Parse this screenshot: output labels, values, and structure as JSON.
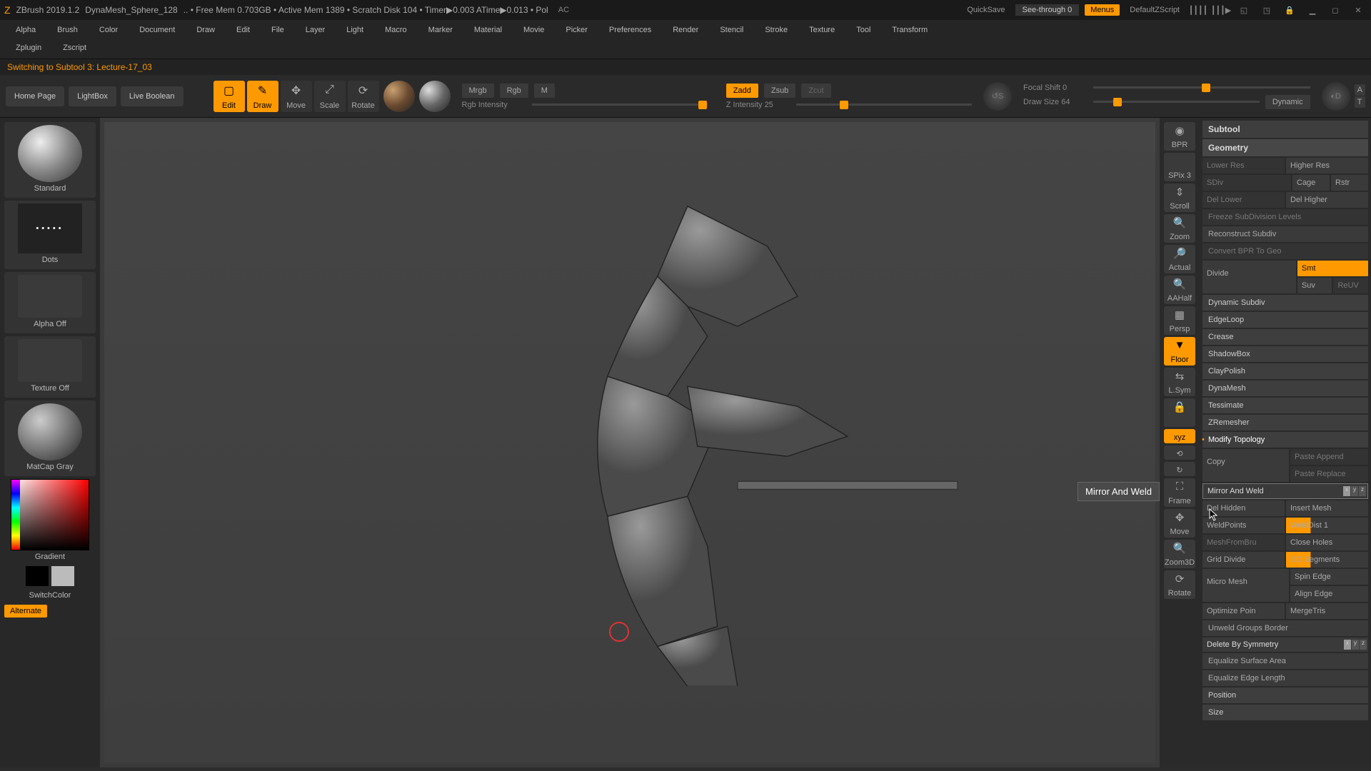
{
  "titlebar": {
    "app": "ZBrush 2019.1.2",
    "doc": "DynaMesh_Sphere_128",
    "stats": ".. • Free Mem 0.703GB • Active Mem 1389 • Scratch Disk 104 • Timer▶0.003 ATime▶0.013 • Pol",
    "ac": "AC",
    "quicksave": "QuickSave",
    "seethrough": "See-through  0",
    "menus": "Menus",
    "default_zscript": "DefaultZScript"
  },
  "menu": {
    "items": [
      "Alpha",
      "Brush",
      "Color",
      "Document",
      "Draw",
      "Edit",
      "File",
      "Layer",
      "Light",
      "Macro",
      "Marker",
      "Material",
      "Movie",
      "Picker",
      "Preferences",
      "Render",
      "Stencil",
      "Stroke",
      "Texture",
      "Tool",
      "Transform"
    ],
    "items2": [
      "Zplugin",
      "Zscript"
    ]
  },
  "status_line": "Switching to Subtool 3: Lecture-17_03",
  "toolbar": {
    "home": "Home Page",
    "lightbox": "LightBox",
    "livebool": "Live Boolean",
    "modes": {
      "edit": "Edit",
      "draw": "Draw",
      "move": "Move",
      "scale": "Scale",
      "rotate": "Rotate"
    },
    "mrgb": "Mrgb",
    "rgb": "Rgb",
    "m": "M",
    "zadd": "Zadd",
    "zsub": "Zsub",
    "zcut": "Zcut",
    "rgb_intensity": "Rgb Intensity",
    "z_intensity": "Z Intensity  25",
    "focal_shift": "Focal Shift  0",
    "draw_size": "Draw Size  64",
    "dynamic": "Dynamic",
    "a": "A",
    "s": "S",
    "d": "D",
    "t": "T"
  },
  "left": {
    "brush_name": "Standard",
    "stroke_name": "Dots",
    "alpha": "Alpha Off",
    "texture": "Texture Off",
    "matcap": "MatCap Gray",
    "gradient": "Gradient",
    "switchcolor": "SwitchColor",
    "alternate": "Alternate"
  },
  "viewport": {
    "tooltip": "Mirror And Weld"
  },
  "right_strip": {
    "bpr": "BPR",
    "spix": "SPix 3",
    "scroll": "Scroll",
    "zoom": "Zoom",
    "actual": "Actual",
    "aahalf": "AAHalf",
    "persp": "Persp",
    "floor": "Floor",
    "lsym": "L.Sym",
    "xyz": "xyz",
    "frame": "Frame",
    "move": "Move",
    "zoom3d": "Zoom3D",
    "rotate": "Rotate"
  },
  "inspector": {
    "subtool": "Subtool",
    "geometry": "Geometry",
    "lower_res": "Lower Res",
    "higher_res": "Higher Res",
    "sdiv": "SDiv",
    "cage": "Cage",
    "rstr": "Rstr",
    "del_lower": "Del Lower",
    "del_higher": "Del Higher",
    "freeze": "Freeze SubDivision Levels",
    "reconstruct": "Reconstruct Subdiv",
    "convert": "Convert BPR To Geo",
    "divide": "Divide",
    "smt": "Smt",
    "suv": "Suv",
    "reuv": "ReUV",
    "dynamic_subdiv": "Dynamic Subdiv",
    "edgeloop": "EdgeLoop",
    "crease": "Crease",
    "shadowbox": "ShadowBox",
    "claypolish": "ClayPolish",
    "dynamesh": "DynaMesh",
    "tessimate": "Tessimate",
    "zremesher": "ZRemesher",
    "modify_topo": "Modify Topology",
    "copy": "Copy",
    "paste_append": "Paste Append",
    "paste_replace": "Paste Replace",
    "mirror_weld": "Mirror And Weld",
    "del_hidden": "Del Hidden",
    "insert_mesh": "Insert Mesh",
    "weldpoints": "WeldPoints",
    "welddist": "WeldDist 1",
    "meshfrombrush": "MeshFromBru",
    "close_holes": "Close Holes",
    "grid_divide": "Grid Divide",
    "gd_segments": "GD Segments",
    "micro_mesh": "Micro Mesh",
    "spin_edge": "Spin Edge",
    "align_edge": "Align Edge",
    "optimize": "Optimize Poin",
    "mergetris": "MergeTris",
    "unweld": "Unweld Groups Border",
    "delete_sym": "Delete By Symmetry",
    "eq_surface": "Equalize Surface Area",
    "eq_edge": "Equalize Edge Length",
    "position": "Position",
    "size": "Size"
  }
}
